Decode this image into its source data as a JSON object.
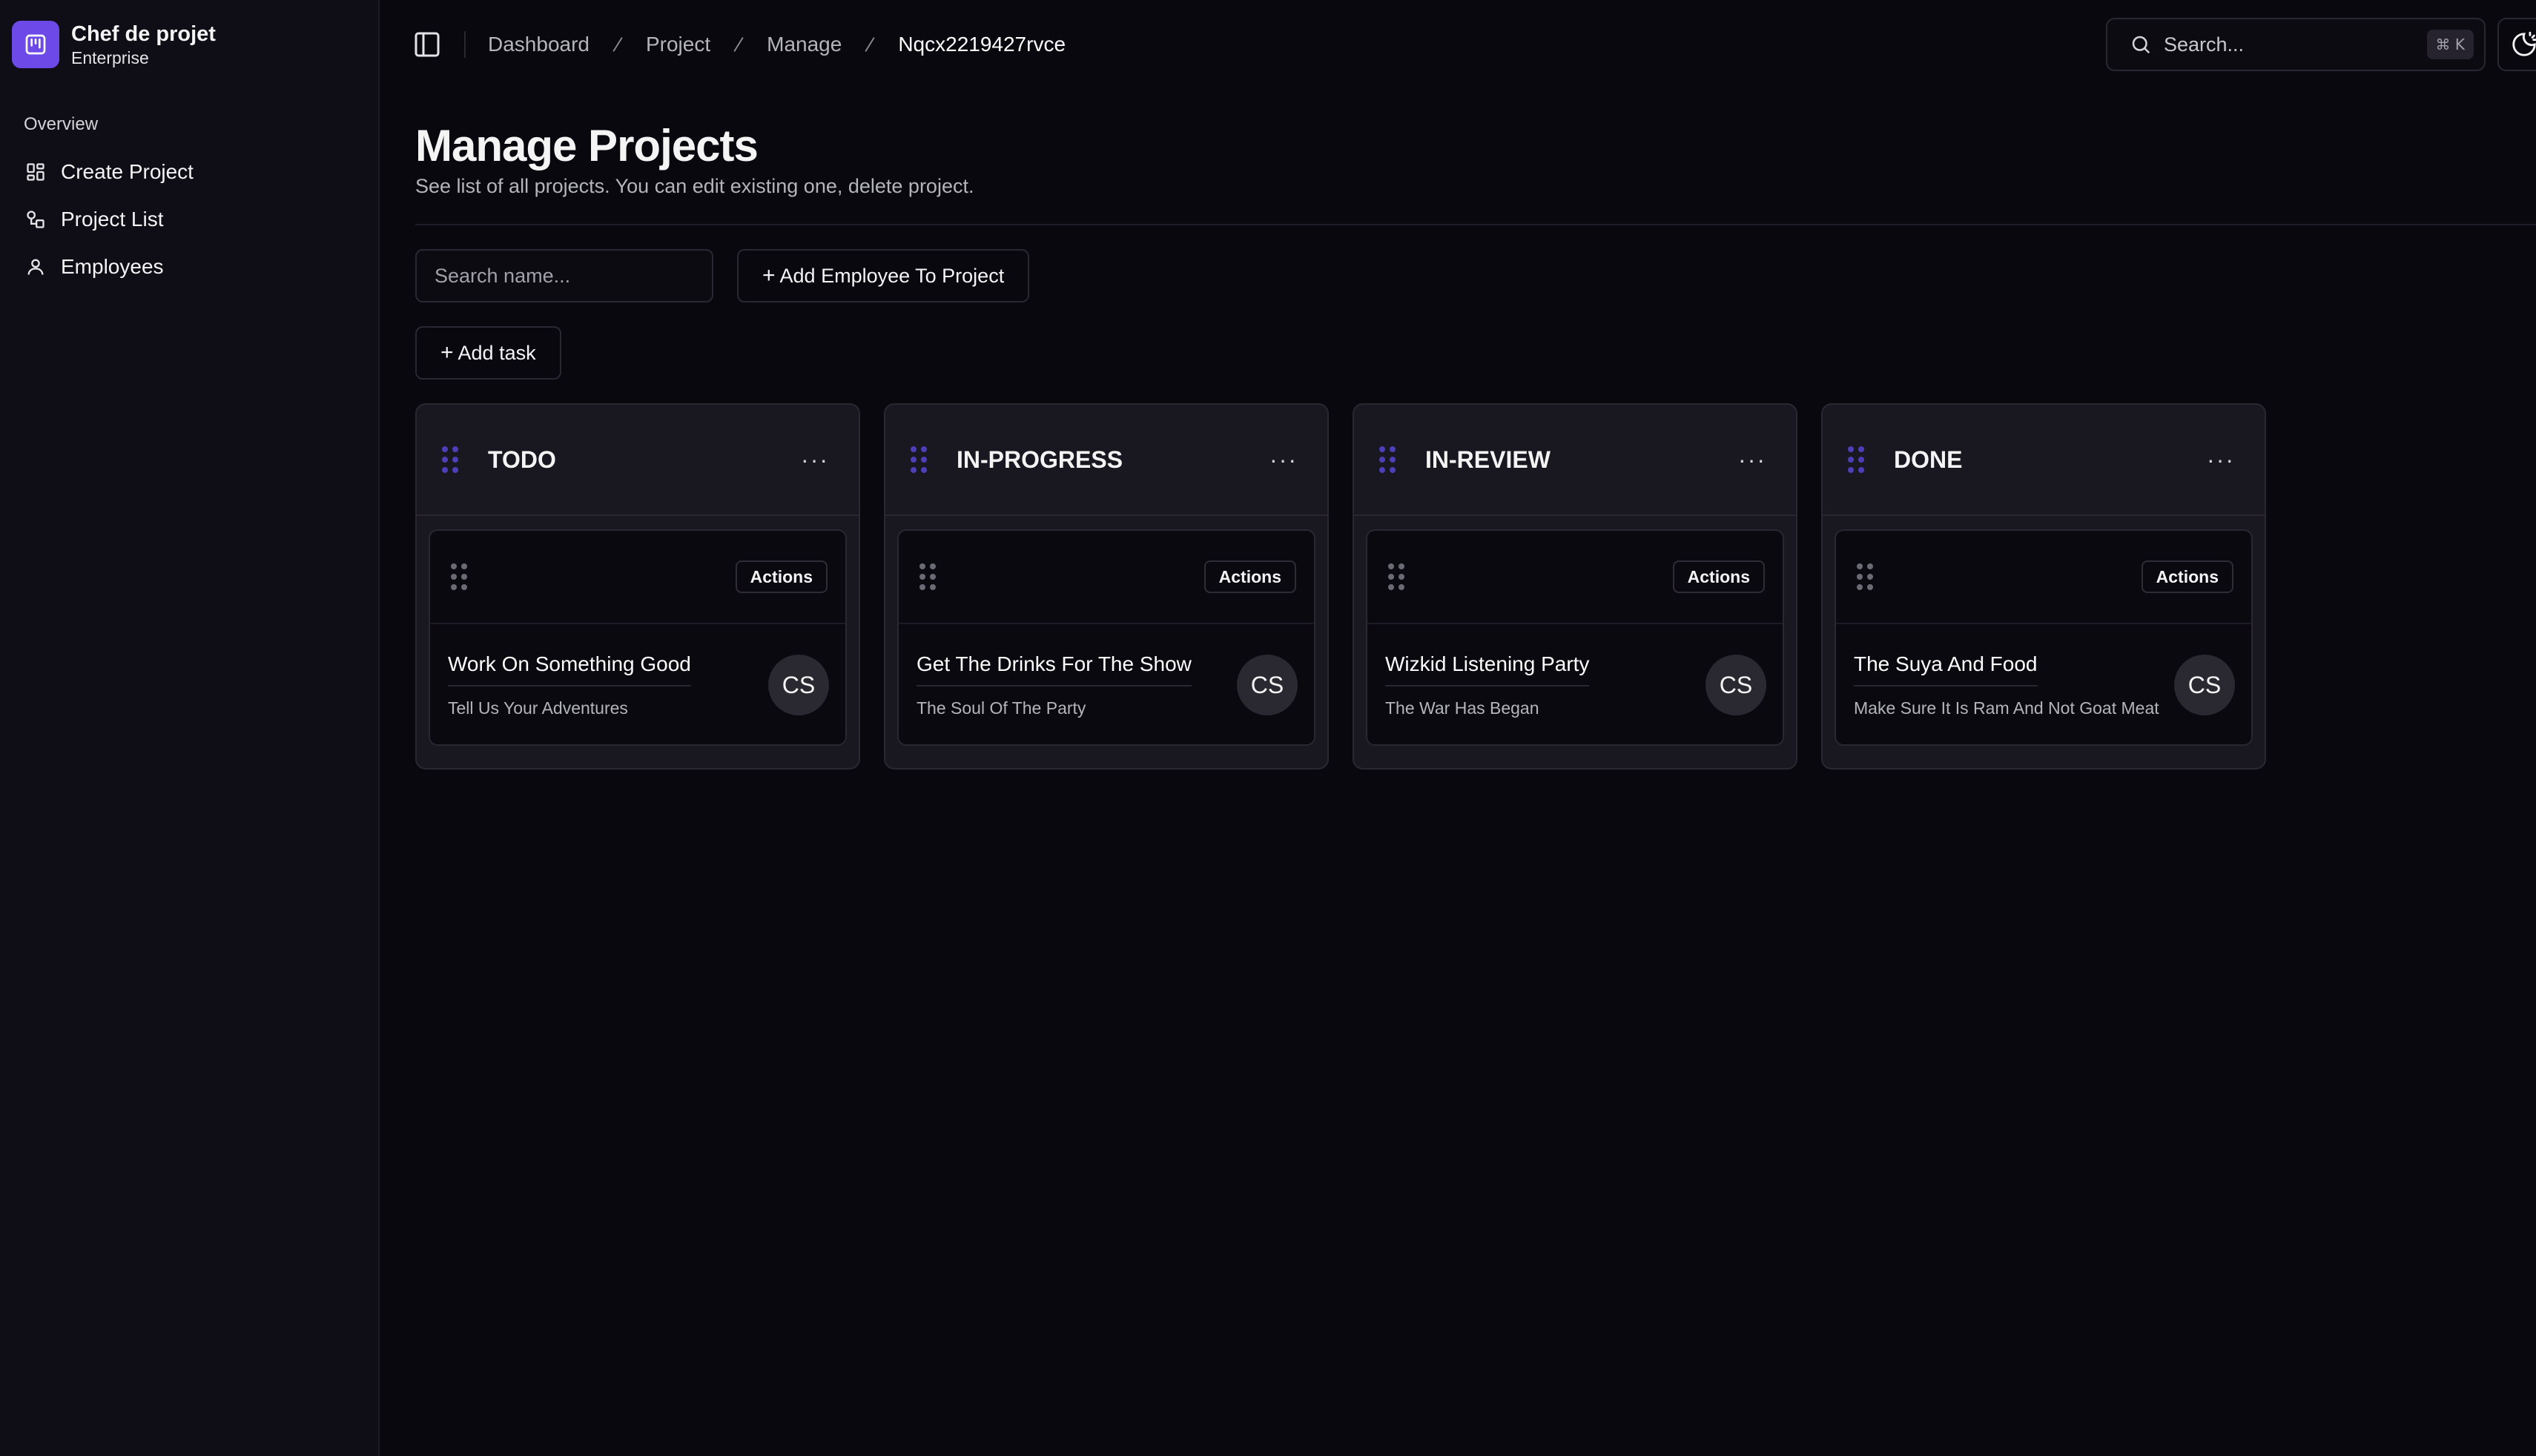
{
  "brand": {
    "name": "Chef de projet",
    "subtitle": "Enterprise",
    "color": "#6d4ae8"
  },
  "sidebar": {
    "group_label": "Overview",
    "items": [
      {
        "label": "Create Project",
        "icon": "dashboard-icon"
      },
      {
        "label": "Project List",
        "icon": "shapes-icon"
      },
      {
        "label": "Employees",
        "icon": "user-icon"
      }
    ]
  },
  "breadcrumb": [
    "Dashboard",
    "Project",
    "Manage",
    "Nqcx2219427rvce"
  ],
  "search": {
    "placeholder": "Search...",
    "shortcut": "⌘ K"
  },
  "page": {
    "title": "Manage Projects",
    "description": "See list of all projects. You can edit existing one, delete project."
  },
  "toolbar": {
    "search_placeholder": "Search name...",
    "add_employee_label": "Add Employee To Project",
    "add_task_label": "Add task"
  },
  "columns": [
    {
      "title": "TODO",
      "cards": [
        {
          "title": "Work On Something Good",
          "subtitle": "Tell Us Your Adventures",
          "avatar": "CS",
          "actions": "Actions"
        }
      ]
    },
    {
      "title": "IN-PROGRESS",
      "cards": [
        {
          "title": "Get The Drinks For The Show",
          "subtitle": "The Soul Of The Party",
          "avatar": "CS",
          "actions": "Actions"
        }
      ]
    },
    {
      "title": "IN-REVIEW",
      "cards": [
        {
          "title": "Wizkid Listening Party",
          "subtitle": "The War Has Began",
          "avatar": "CS",
          "actions": "Actions"
        }
      ]
    },
    {
      "title": "DONE",
      "cards": [
        {
          "title": "The Suya And Food",
          "subtitle": "Make Sure It Is Ram And Not Goat Meat",
          "avatar": "CS",
          "actions": "Actions"
        }
      ]
    }
  ]
}
